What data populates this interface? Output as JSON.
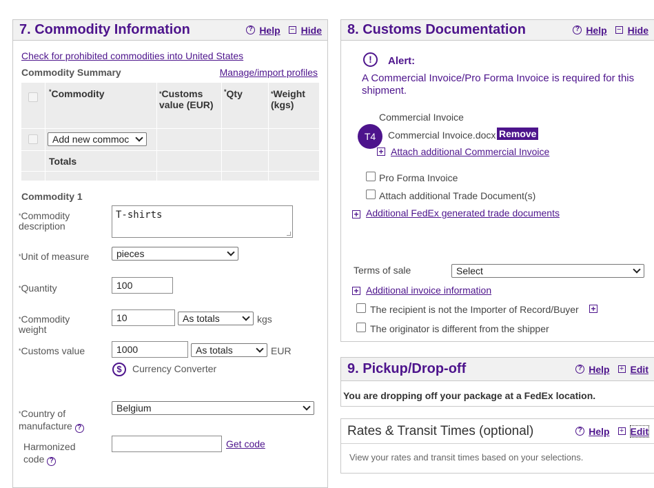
{
  "commodity": {
    "title": "7. Commodity Information",
    "help": "Help",
    "hide": "Hide",
    "prohibited_link": "Check for prohibited commodities into United States",
    "summary_label": "Commodity Summary",
    "manage_link": "Manage/import profiles",
    "table": {
      "headers": [
        "Commodity",
        "Customs value (EUR)",
        "Qty",
        "Weight (kgs)"
      ],
      "add_select": "Add new commoc",
      "totals": "Totals"
    },
    "section_label": "Commodity 1",
    "description_label": "Commodity description",
    "description_value": "T-shirts",
    "unit_label": "Unit of measure",
    "unit_value": "pieces",
    "quantity_label": "Quantity",
    "quantity_value": "100",
    "weight_label": "Commodity weight",
    "weight_value": "10",
    "weight_mode": "As totals",
    "weight_unit": "kgs",
    "customs_label": "Customs value",
    "customs_value": "1000",
    "customs_mode": "As totals",
    "customs_unit": "EUR",
    "currency_converter": "Currency Converter",
    "country_label": "Country of manufacture",
    "country_value": "Belgium",
    "harmonized_label": "Harmonized code",
    "get_code": "Get code"
  },
  "customs": {
    "title": "8. Customs Documentation",
    "help": "Help",
    "hide": "Hide",
    "alert_title": "Alert:",
    "alert_text": "A Commercial Invoice/Pro Forma Invoice is required for this shipment.",
    "commercial_invoice": "Commercial Invoice",
    "file_badge": "T4",
    "file_name": "Commercial Invoice.docx",
    "remove": "Remove",
    "attach_ci": "Attach additional Commercial Invoice",
    "pro_forma": "Pro Forma Invoice",
    "attach_trade": "Attach additional Trade Document(s)",
    "additional_docs": "Additional FedEx generated trade documents",
    "terms_label": "Terms of sale",
    "terms_value": "Select",
    "additional_invoice": "Additional invoice information",
    "recipient_not_importer": "The recipient is not the Importer of Record/Buyer",
    "originator_different": "The originator is different from the shipper"
  },
  "pickup": {
    "title": "9. Pickup/Drop-off",
    "help": "Help",
    "edit": "Edit",
    "text": "You are dropping off your package at a FedEx location."
  },
  "rates": {
    "title": "Rates & Transit Times (optional)",
    "help": "Help",
    "edit": "Edit",
    "text": "View your rates and transit times based on your selections."
  },
  "colors": {
    "brand_purple": "#4d148c",
    "checkbox_blue": "#2f6fde",
    "header_bg": "#f1f1f1",
    "table_bg": "#ececec"
  }
}
